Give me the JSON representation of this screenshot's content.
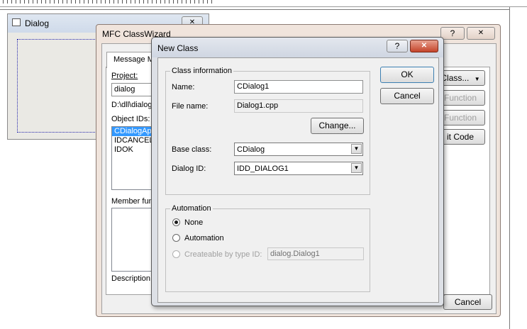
{
  "small_dialog": {
    "title": "Dialog"
  },
  "wizard": {
    "title": "MFC ClassWizard",
    "help_glyph": "?",
    "close_glyph": "✕",
    "tab_label": "Message M",
    "project_label": "Project:",
    "project_value": "dialog",
    "path_value": "D:\\dll\\dialog",
    "object_ids_label": "Object IDs:",
    "object_ids": [
      "CDialogApp",
      "IDCANCEL",
      "IDOK"
    ],
    "member_label": "Member fun",
    "description_label": "Description:",
    "add_class_button": "Class...",
    "add_function_button": "Function",
    "delete_function_button": "Function",
    "edit_code_button": "it Code",
    "cancel_button": "Cancel"
  },
  "new_class": {
    "title": "New Class",
    "help_glyph": "?",
    "close_glyph": "✕",
    "class_info_legend": "Class information",
    "name_label": "Name:",
    "name_value": "CDialog1",
    "file_name_label": "File name:",
    "file_name_value": "Dialog1.cpp",
    "change_button": "Change...",
    "base_class_label": "Base class:",
    "base_class_value": "CDialog",
    "dialog_id_label": "Dialog ID:",
    "dialog_id_value": "IDD_DIALOG1",
    "ok_button": "OK",
    "cancel_button": "Cancel",
    "automation_legend": "Automation",
    "radio_none": "None",
    "radio_automation": "Automation",
    "radio_createable": "Createable by type ID:",
    "type_id_value": "dialog.Dialog1"
  }
}
